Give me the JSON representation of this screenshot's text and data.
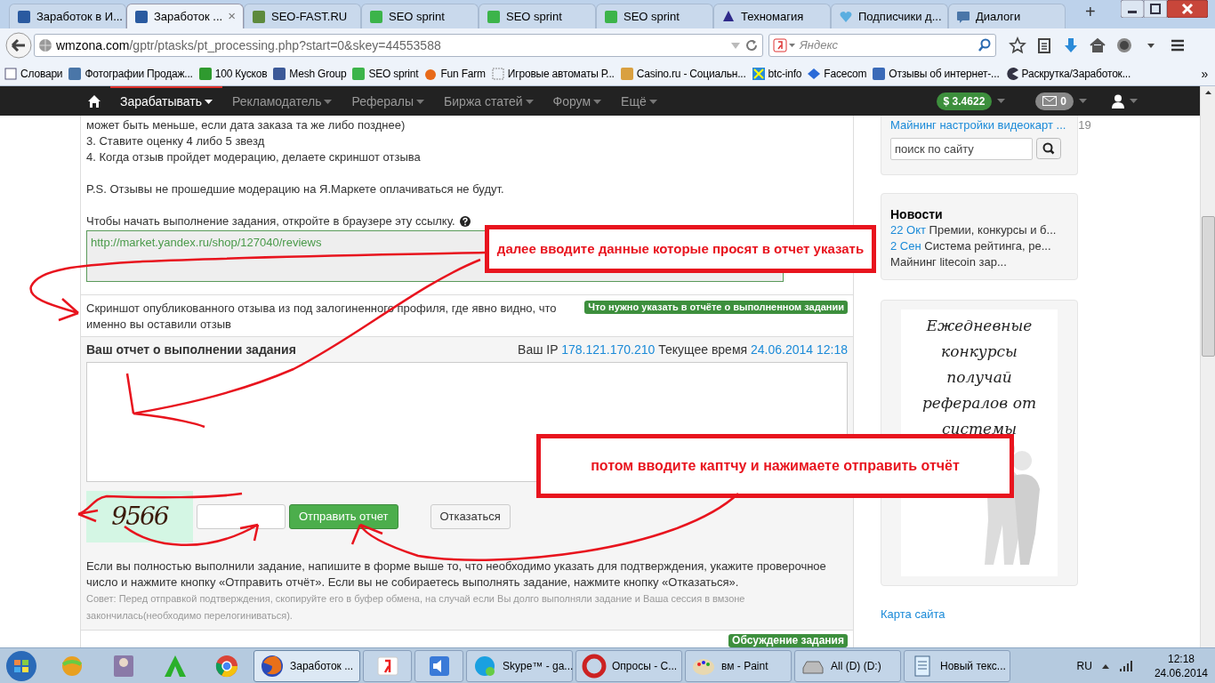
{
  "browser": {
    "tabs": [
      {
        "label": "Заработок в И...",
        "selected": false
      },
      {
        "label": "Заработок ...",
        "selected": true,
        "close": "×"
      },
      {
        "label": "SEO-FAST.RU",
        "selected": false
      },
      {
        "label": "SEO sprint",
        "selected": false
      },
      {
        "label": "SEO sprint",
        "selected": false
      },
      {
        "label": "SEO sprint",
        "selected": false
      },
      {
        "label": "Техномагия",
        "selected": false
      },
      {
        "label": "Подписчики д...",
        "selected": false
      },
      {
        "label": "Диалоги",
        "selected": false
      }
    ],
    "new_tab": "+",
    "address": {
      "host": "wmzona.com",
      "path": "/gptr/ptasks/pt_processing.php?start=0&skey=44553588"
    },
    "search": {
      "placeholder": "Яндекс"
    },
    "bookmarks": [
      "Словари",
      "Фотографии Продаж...",
      "100 Кусков",
      "Mesh Group",
      "SEO sprint",
      "Fun Farm",
      "Игровые автоматы Р...",
      "Casino.ru - Социальн...",
      "btc-info",
      "Facecom",
      "Отзывы об интернет-...",
      "Раскрутка/Заработок..."
    ],
    "bookmarks_more": "»"
  },
  "site_nav": {
    "items": [
      {
        "label": "Зарабатывать",
        "selected": true
      },
      {
        "label": "Рекламодатель",
        "selected": false
      },
      {
        "label": "Рефералы",
        "selected": false
      },
      {
        "label": "Биржа статей",
        "selected": false
      },
      {
        "label": "Форум",
        "selected": false
      },
      {
        "label": "Ещё",
        "selected": false
      }
    ],
    "balance": "$ 3.4622",
    "messages": "0"
  },
  "task": {
    "paragraphs": [
      [
        "может быть меньше, если дата заказа та же либо позднее)",
        "3. Ставите оценку 4 либо 5 звезд",
        "4. Когда отзыв пройдет модерацию, делаете скриншот отзыва"
      ],
      [
        "P.S. Отзывы не прошедшие модерацию на Я.Маркете оплачиваться не будут."
      ]
    ],
    "link_prompt": "Чтобы начать выполнение задания, откройте в браузере эту ссылку.",
    "link": "http://market.yandex.ru/shop/127040/reviews",
    "requirement": "Скриншот опубликованного отзыва из под залогиненного профиля, где явно видно, что именно вы оставили отзыв",
    "requirement_badge": "Что нужно указать в отчёте о выполненном задании"
  },
  "report": {
    "title": "Ваш отчет о выполнении задания",
    "ip_label": "Ваш IP",
    "ip": "178.121.170.210",
    "time_label": "Текущее время",
    "time": "24.06.2014 12:18",
    "captcha": "9566",
    "submit": "Отправить отчет",
    "decline": "Отказаться",
    "instructions": "Если вы полностью выполнили задание, напишите в форме выше то, что необходимо указать для подтверждения, укажите проверочное число и нажмите кнопку «Отправить отчёт». Если вы не собираетесь выполнять задание, нажмите кнопку «Отказаться».",
    "tip": "Совет: Перед отправкой подтверждения, скопируйте его в буфер обмена, на случай если Вы долго выполняли задание и Ваша сессия в вмзоне закончилась(необходимо перелогиниваться).",
    "discussion_badge": "Обсуждение задания"
  },
  "sidebar": {
    "top_link": "Майнинг настройки видеокарт ...",
    "top_count": "19",
    "search_placeholder": "поиск по сайту",
    "news_title": "Новости",
    "news": [
      {
        "date": "22 Окт",
        "text": "Премии, конкурсы и б..."
      },
      {
        "date": "2 Сен",
        "text": "Система рейтинга, ре..."
      },
      {
        "text": "Майнинг litecoin зар..."
      }
    ],
    "banner_lines": [
      "Ежедневные",
      "конкурсы",
      "получай",
      "рефералов от",
      "системы"
    ],
    "sitemap": "Карта сайта"
  },
  "annotations": [
    {
      "text": "далее вводите данные которые просят в отчет указать"
    },
    {
      "text": "потом вводите каптчу и нажимаете отправить отчёт"
    }
  ],
  "taskbar": {
    "tasks": [
      {
        "label": "Заработок ...",
        "selected": true
      },
      {
        "selected": false
      },
      {
        "selected": false
      },
      {
        "label": "Skype™ - ga...",
        "selected": false
      },
      {
        "label": "Опросы - С...",
        "selected": false
      },
      {
        "label": "вм - Paint",
        "selected": false
      },
      {
        "label": "All (D) (D:)",
        "selected": false
      },
      {
        "label": "Новый текс...",
        "selected": false
      }
    ],
    "language": "RU",
    "time": "12:18",
    "date": "24.06.2014"
  }
}
